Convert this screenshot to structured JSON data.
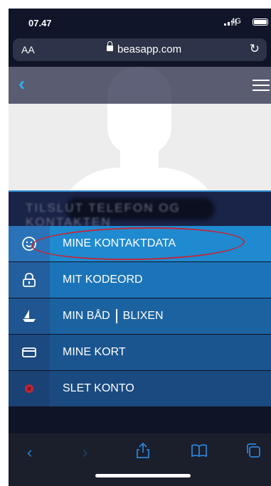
{
  "status": {
    "time": "07.47",
    "network": "4G"
  },
  "browser": {
    "text_size": "AA",
    "url": "beasapp.com",
    "reload_icon": "reload-icon"
  },
  "header": {
    "back_icon": "back-chevron-icon",
    "menu_icon": "hamburger-menu-icon"
  },
  "profile": {
    "avatar_icon": "default-avatar-silhouette"
  },
  "title": {
    "text": "TILSLUT TELEFON OG KONTAKTEN"
  },
  "menu": {
    "items": [
      {
        "label": "MINE KONTAKTDATA",
        "icon": "smiley-icon"
      },
      {
        "label": "MIT KODEORD",
        "icon": "lock-icon"
      },
      {
        "label": "MIN BÅD",
        "label_b": "BLIXEN",
        "icon": "sailboat-icon"
      },
      {
        "label": "MINE KORT",
        "icon": "card-icon"
      },
      {
        "label": "SLET KONTO",
        "icon": "delete-icon"
      }
    ]
  },
  "toolbar": {
    "back": "‹",
    "forward": "›",
    "share_icon": "share-icon",
    "bookmarks_icon": "book-icon",
    "tabs_icon": "tabs-icon"
  },
  "colors": {
    "accent": "#2ab0f0",
    "annotation": "#c0283a"
  }
}
